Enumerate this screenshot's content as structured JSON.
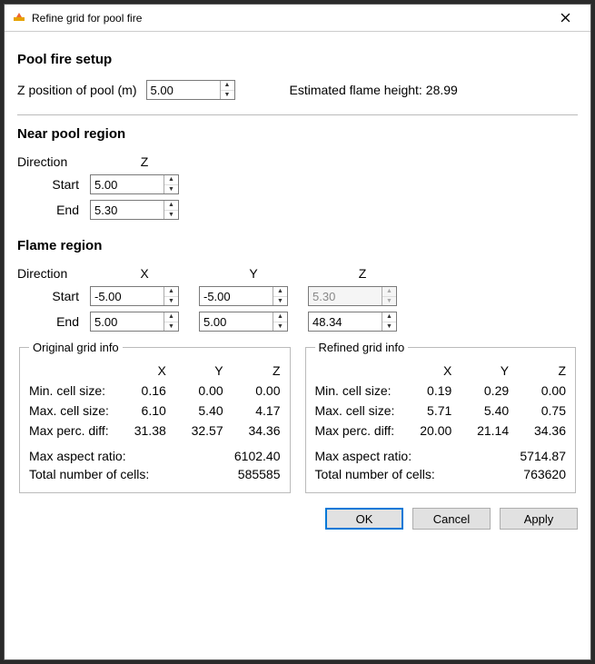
{
  "window": {
    "title": "Refine grid for pool fire"
  },
  "section_pool": {
    "title": "Pool fire setup",
    "zpos_label": "Z position of pool (m)",
    "zpos_value": "5.00",
    "flame_label": "Estimated flame height:",
    "flame_value": "28.99"
  },
  "section_near": {
    "title": "Near pool region",
    "dir_label": "Direction",
    "z_hdr": "Z",
    "start_label": "Start",
    "start_value": "5.00",
    "end_label": "End",
    "end_value": "5.30"
  },
  "section_flame": {
    "title": "Flame region",
    "dir_label": "Direction",
    "hdr_x": "X",
    "hdr_y": "Y",
    "hdr_z": "Z",
    "start_label": "Start",
    "start_x": "-5.00",
    "start_y": "-5.00",
    "start_z": "5.30",
    "end_label": "End",
    "end_x": "5.00",
    "end_y": "5.00",
    "end_z": "48.34"
  },
  "grid_original": {
    "legend": "Original grid info",
    "hdr_x": "X",
    "hdr_y": "Y",
    "hdr_z": "Z",
    "row_min": "Min. cell size:",
    "min_x": "0.16",
    "min_y": "0.00",
    "min_z": "0.00",
    "row_max": "Max. cell size:",
    "max_x": "6.10",
    "max_y": "5.40",
    "max_z": "4.17",
    "row_perc": "Max perc. diff:",
    "perc_x": "31.38",
    "perc_y": "32.57",
    "perc_z": "34.36",
    "aspect_label": "Max aspect ratio:",
    "aspect_value": "6102.40",
    "cells_label": "Total number of cells:",
    "cells_value": "585585"
  },
  "grid_refined": {
    "legend": "Refined grid info",
    "hdr_x": "X",
    "hdr_y": "Y",
    "hdr_z": "Z",
    "row_min": "Min. cell size:",
    "min_x": "0.19",
    "min_y": "0.29",
    "min_z": "0.00",
    "row_max": "Max. cell size:",
    "max_x": "5.71",
    "max_y": "5.40",
    "max_z": "0.75",
    "row_perc": "Max perc. diff:",
    "perc_x": "20.00",
    "perc_y": "21.14",
    "perc_z": "34.36",
    "aspect_label": "Max aspect ratio:",
    "aspect_value": "5714.87",
    "cells_label": "Total number of cells:",
    "cells_value": "763620"
  },
  "buttons": {
    "ok": "OK",
    "cancel": "Cancel",
    "apply": "Apply"
  }
}
